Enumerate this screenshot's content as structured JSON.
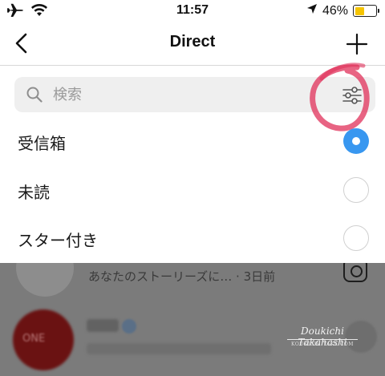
{
  "status_bar": {
    "time": "11:57",
    "battery_percent": "46%",
    "battery_level": 0.46,
    "icons": [
      "airplane-icon",
      "wifi-icon",
      "location-arrow-icon",
      "battery-icon"
    ]
  },
  "nav": {
    "title": "Direct",
    "back_icon": "chevron-left-icon",
    "add_icon": "plus-icon"
  },
  "search": {
    "placeholder": "検索",
    "icon": "search-icon",
    "filter_icon": "filter-sliders-icon"
  },
  "filter_options": [
    {
      "label": "受信箱",
      "selected": true
    },
    {
      "label": "未読",
      "selected": false
    },
    {
      "label": "スター付き",
      "selected": false
    }
  ],
  "background_list": {
    "item1_preview": "あなたのストーリーズに…",
    "item1_time": "· 3日前",
    "item2_avatar_text": "ONE"
  },
  "watermark": {
    "name": "Doukichi Takahashi",
    "subtitle": "KOUKICHI TAKA.COM"
  },
  "colors": {
    "accent": "#3897f0",
    "battery": "#f5c400",
    "annotation": "#e0305a"
  }
}
